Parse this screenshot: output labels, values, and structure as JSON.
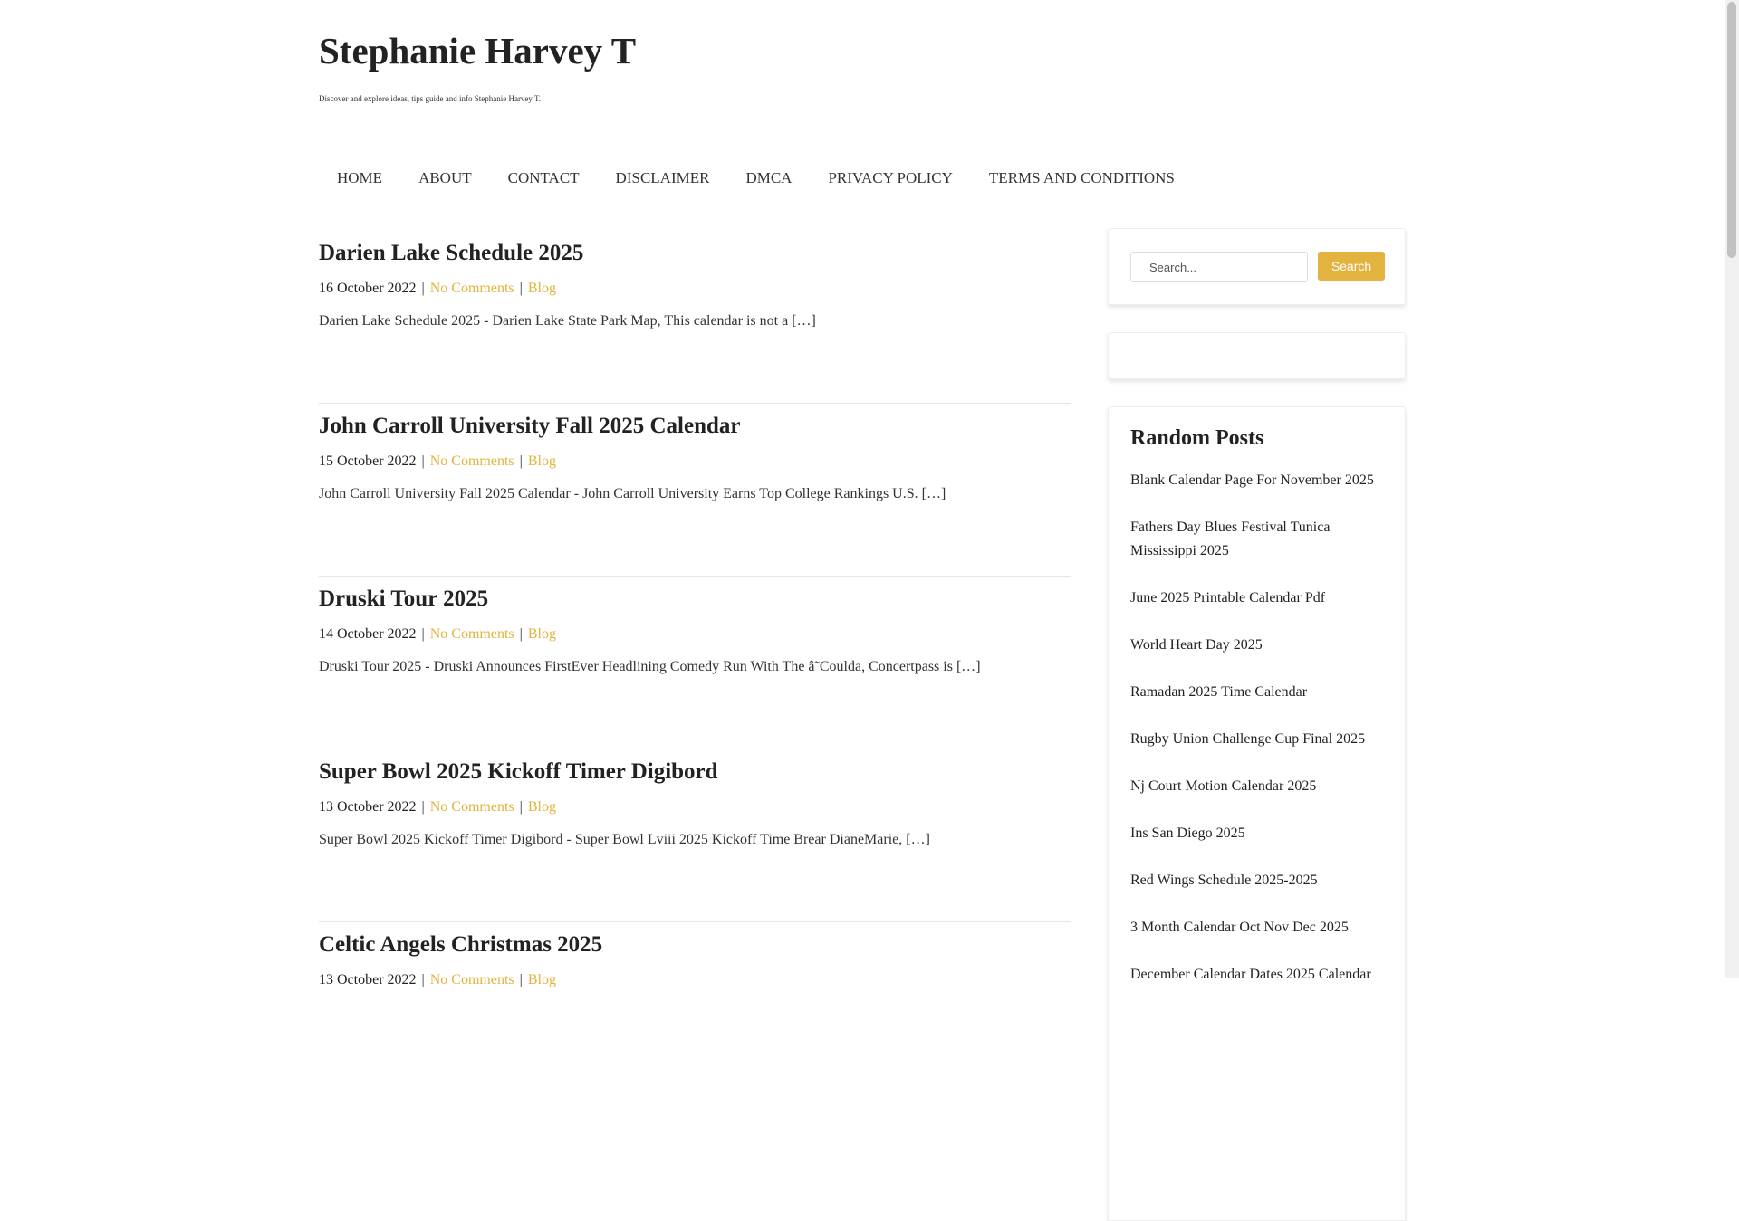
{
  "site": {
    "title": "Stephanie Harvey T",
    "description": "Discover and explore ideas, tips guide and info Stephanie Harvey T."
  },
  "nav": [
    "HOME",
    "ABOUT",
    "CONTACT",
    "DISCLAIMER",
    "DMCA",
    "PRIVACY POLICY",
    "TERMS AND CONDITIONS"
  ],
  "posts": [
    {
      "title": "Darien Lake Schedule 2025",
      "date": "16 October 2022",
      "comments": "No Comments",
      "category": "Blog",
      "excerpt": "Darien Lake Schedule 2025 - Darien Lake State Park Map, This calendar is not a […]"
    },
    {
      "title": "John Carroll University Fall 2025 Calendar",
      "date": "15 October 2022",
      "comments": "No Comments",
      "category": "Blog",
      "excerpt": "John Carroll University Fall 2025 Calendar - John Carroll University Earns Top College Rankings U.S. […]"
    },
    {
      "title": "Druski Tour 2025",
      "date": "14 October 2022",
      "comments": "No Comments",
      "category": "Blog",
      "excerpt": "Druski Tour 2025 - Druski Announces FirstEver Headlining Comedy Run With The â˜Coulda, Concertpass is […]"
    },
    {
      "title": "Super Bowl 2025 Kickoff Timer Digibord",
      "date": "13 October 2022",
      "comments": "No Comments",
      "category": "Blog",
      "excerpt": "Super Bowl 2025 Kickoff Timer Digibord - Super Bowl Lviii 2025 Kickoff Time Brear DianeMarie, […]"
    },
    {
      "title": "Celtic Angels Christmas 2025",
      "date": "13 October 2022",
      "comments": "No Comments",
      "category": "Blog",
      "excerpt": ""
    }
  ],
  "meta_separator": "|",
  "sidebar": {
    "search": {
      "placeholder": "Search...",
      "button_label": "Search"
    },
    "random_posts": {
      "title": "Random Posts",
      "items": [
        "Blank Calendar Page For November 2025",
        "Fathers Day Blues Festival Tunica Mississippi 2025",
        "June 2025 Printable Calendar Pdf",
        "World Heart Day 2025",
        "Ramadan 2025 Time Calendar",
        "Rugby Union Challenge Cup Final 2025",
        "Nj Court Motion Calendar 2025",
        "Ins San Diego 2025",
        "Red Wings Schedule 2025-2025",
        "3 Month Calendar Oct Nov Dec 2025",
        "December Calendar Dates 2025 Calendar"
      ]
    }
  },
  "colors": {
    "accent": "#e2b33f",
    "text": "#222222"
  }
}
